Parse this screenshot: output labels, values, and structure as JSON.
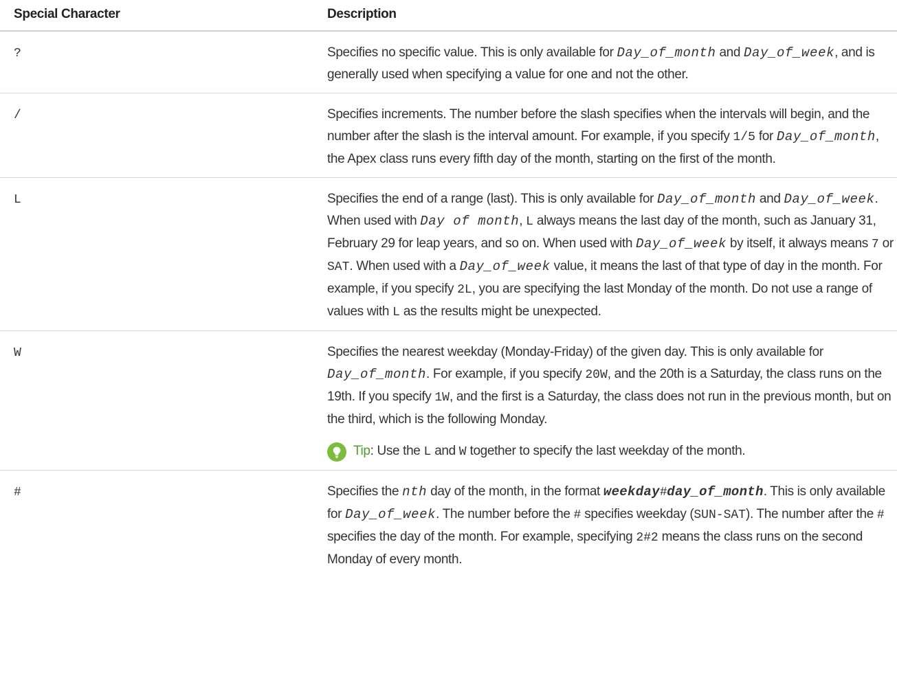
{
  "table": {
    "headers": [
      "Special Character",
      "Description"
    ],
    "rows": [
      {
        "char": "?",
        "desc": [
          {
            "t": "Specifies no specific value. This is only available for "
          },
          {
            "t": "Day_of_month",
            "s": "var"
          },
          {
            "t": " and "
          },
          {
            "t": "Day_of_week",
            "s": "var"
          },
          {
            "t": ", and is generally used when specifying a value for one and not the other."
          }
        ]
      },
      {
        "char": "/",
        "desc": [
          {
            "t": "Specifies increments. The number before the slash specifies when the intervals will begin, and the number after the slash is the interval amount. For example, if you specify "
          },
          {
            "t": "1/5",
            "s": "mono"
          },
          {
            "t": " for "
          },
          {
            "t": "Day_of_month",
            "s": "var"
          },
          {
            "t": ", the Apex class runs every fifth day of the month, starting on the first of the month."
          }
        ]
      },
      {
        "char": "L",
        "desc": [
          {
            "t": "Specifies the end of a range (last). This is only available for "
          },
          {
            "t": "Day_of_month",
            "s": "var"
          },
          {
            "t": " and "
          },
          {
            "t": "Day_of_week",
            "s": "var"
          },
          {
            "t": ". When used with "
          },
          {
            "t": "Day of month",
            "s": "var"
          },
          {
            "t": ", "
          },
          {
            "t": "L",
            "s": "mono"
          },
          {
            "t": " always means the last day of the month, such as January 31, February 29 for leap years, and so on. When used with "
          },
          {
            "t": "Day_of_week",
            "s": "var"
          },
          {
            "t": " by itself, it always means "
          },
          {
            "t": "7",
            "s": "mono"
          },
          {
            "t": " or "
          },
          {
            "t": "SAT",
            "s": "mono"
          },
          {
            "t": ". When used with a "
          },
          {
            "t": "Day_of_week",
            "s": "var"
          },
          {
            "t": " value, it means the last of that type of day in the month. For example, if you specify "
          },
          {
            "t": "2L",
            "s": "mono"
          },
          {
            "t": ", you are specifying the last Monday of the month. Do not use a range of values with "
          },
          {
            "t": "L",
            "s": "mono"
          },
          {
            "t": " as the results might be unexpected."
          }
        ]
      },
      {
        "char": "W",
        "desc": [
          {
            "t": "Specifies the nearest weekday (Monday-Friday) of the given day. This is only available for "
          },
          {
            "t": "Day_of_month",
            "s": "var"
          },
          {
            "t": ". For example, if you specify "
          },
          {
            "t": "20W",
            "s": "mono"
          },
          {
            "t": ", and the 20th is a Saturday, the class runs on the 19th. If you specify "
          },
          {
            "t": "1W",
            "s": "mono"
          },
          {
            "t": ", and the first is a Saturday, the class does not run in the previous month, but on the third, which is the following Monday."
          }
        ],
        "tip": {
          "label": "Tip",
          "parts": [
            {
              "t": ":  Use the "
            },
            {
              "t": "L",
              "s": "mono"
            },
            {
              "t": " and "
            },
            {
              "t": "W",
              "s": "mono"
            },
            {
              "t": " together to specify the last weekday of the month."
            }
          ]
        }
      },
      {
        "char": "#",
        "desc": [
          {
            "t": "Specifies the "
          },
          {
            "t": "nth",
            "s": "var"
          },
          {
            "t": " day of the month, in the format "
          },
          {
            "t": "weekday",
            "s": "bvar"
          },
          {
            "t": "#",
            "s": "ctxt"
          },
          {
            "t": "day_of_month",
            "s": "bvar"
          },
          {
            "t": ". This is only available for "
          },
          {
            "t": "Day_of_week",
            "s": "var"
          },
          {
            "t": ". The number before the "
          },
          {
            "t": "#",
            "s": "mono"
          },
          {
            "t": " specifies weekday ("
          },
          {
            "t": "SUN-SAT",
            "s": "mono"
          },
          {
            "t": "). The number after the "
          },
          {
            "t": "#",
            "s": "mono"
          },
          {
            "t": " specifies the day of the month. For example, specifying "
          },
          {
            "t": "2#2",
            "s": "mono"
          },
          {
            "t": " means the class runs on the second Monday of every month."
          }
        ]
      }
    ]
  }
}
